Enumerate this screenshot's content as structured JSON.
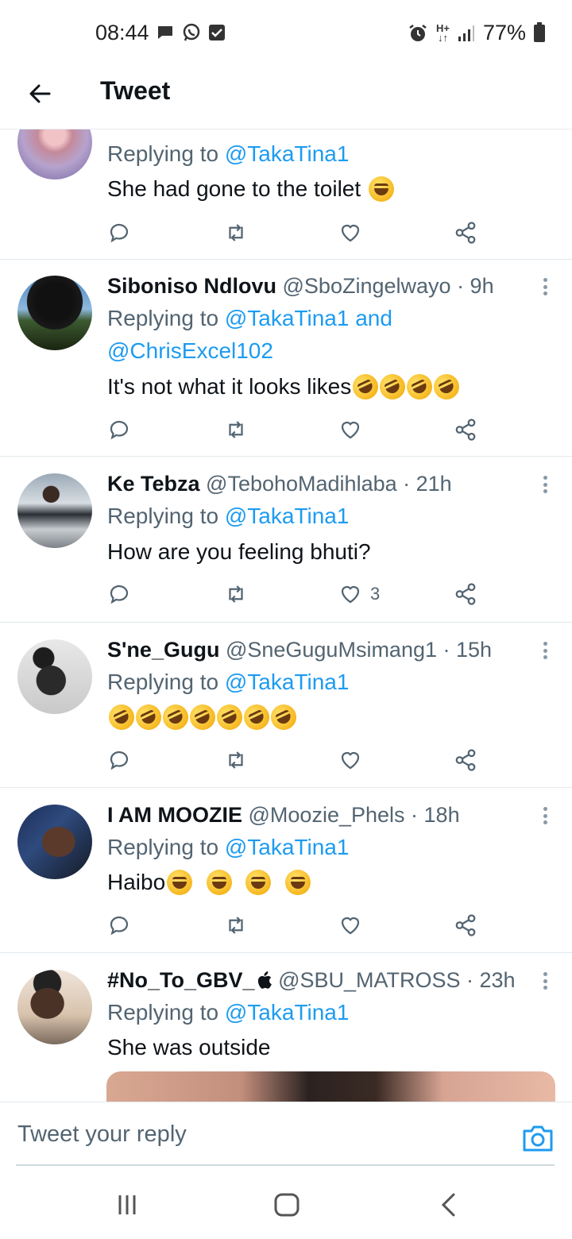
{
  "status_bar": {
    "time": "08:44",
    "battery": "77%",
    "icons": [
      "message-icon",
      "whatsapp-icon",
      "check-icon",
      "alarm-icon",
      "network-icon",
      "signal-icon",
      "battery-icon"
    ]
  },
  "header": {
    "title": "Tweet",
    "back_icon": "arrow-left-icon"
  },
  "tweets": [
    {
      "name": "",
      "handle": "",
      "time": "",
      "replying_prefix": "Replying to ",
      "mentions": "@TakaTina1",
      "body": "She had gone to the toilet",
      "emojis": [
        "joy"
      ],
      "likes": ""
    },
    {
      "name": "Siboniso Ndlovu",
      "handle": "@SboZingelwayo",
      "time": "· 9h",
      "replying_prefix": "Replying to ",
      "mentions": "@TakaTina1 and",
      "mentions_line2": "@ChrisExcel102",
      "body": "It's not what it looks likes",
      "emojis": [
        "rofl",
        "rofl",
        "rofl",
        "rofl"
      ],
      "likes": ""
    },
    {
      "name": "Ke Tebza",
      "handle": "@TebohoMadihlaba",
      "time": "· 21h",
      "replying_prefix": "Replying to ",
      "mentions": "@TakaTina1",
      "body": "How are you feeling bhuti?",
      "emojis": [],
      "likes": "3"
    },
    {
      "name": "S'ne_Gugu",
      "handle": "@SneGuguMsimang1",
      "time": "· 15h",
      "replying_prefix": "Replying to ",
      "mentions": "@TakaTina1",
      "body": "",
      "emojis": [
        "rofl",
        "rofl",
        "rofl",
        "rofl",
        "rofl",
        "rofl",
        "rofl"
      ],
      "likes": ""
    },
    {
      "name": "I AM MOOZIE",
      "handle": "@Moozie_Phels",
      "time": "· 18h",
      "replying_prefix": "Replying to ",
      "mentions": "@TakaTina1",
      "body": "Haibo",
      "emojis": [
        "joy",
        "joy",
        "joy",
        "joy"
      ],
      "likes": ""
    },
    {
      "name": "#No_To_GBV_",
      "handle": "@SBU_MATROSS",
      "time": "· 23h",
      "replying_prefix": "Replying to ",
      "mentions": "@TakaTina1",
      "body": "She was outside",
      "emojis": [],
      "likes": ""
    }
  ],
  "reply_bar": {
    "placeholder": "Tweet your reply",
    "camera_icon": "camera-icon"
  },
  "nav_bar": {
    "icons": [
      "recent-apps-icon",
      "home-icon",
      "back-icon"
    ]
  },
  "colors": {
    "accent": "#1d9bf0",
    "text": "#0f1419",
    "secondary": "#536471",
    "divider": "#e1e8ed"
  }
}
